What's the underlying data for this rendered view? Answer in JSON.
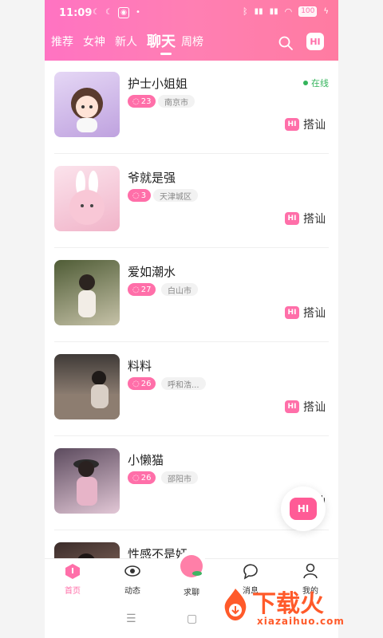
{
  "status": {
    "time": "11:09",
    "battery": "100"
  },
  "tabs": [
    {
      "label": "推荐"
    },
    {
      "label": "女神"
    },
    {
      "label": "新人"
    },
    {
      "label": "聊天"
    },
    {
      "label": "周榜"
    }
  ],
  "header": {
    "hi_label": "HI"
  },
  "items": [
    {
      "name": "护士小姐姐",
      "count": "23",
      "city": "南京市",
      "online": "在线",
      "greet": "搭讪",
      "greet_icon": "HI",
      "avatar_colors": [
        "#d9c8f0",
        "#bfa2df"
      ]
    },
    {
      "name": "爷就是强",
      "count": "3",
      "city": "天津城区",
      "greet": "搭讪",
      "greet_icon": "HI",
      "avatar_colors": [
        "#f7d5e2",
        "#f1b4c9"
      ]
    },
    {
      "name": "爱如潮水",
      "count": "27",
      "city": "白山市",
      "greet": "搭讪",
      "greet_icon": "HI",
      "avatar_colors": [
        "#5c6a41",
        "#c6c2a8"
      ]
    },
    {
      "name": "料料",
      "count": "26",
      "city": "呼和浩...",
      "greet": "搭讪",
      "greet_icon": "HI",
      "avatar_colors": [
        "#6a5a4f",
        "#b9a493"
      ]
    },
    {
      "name": "小懒猫",
      "count": "26",
      "city": "邵阳市",
      "greet": "搭讪",
      "greet_icon": "HI",
      "avatar_colors": [
        "#5c4b5e",
        "#e2c7d6"
      ]
    },
    {
      "name": "性感不是奸",
      "count": "",
      "city": "",
      "greet": "",
      "greet_icon": "",
      "avatar_colors": [
        "#3b2c2a",
        "#a07e6e"
      ]
    }
  ],
  "fab": {
    "label": "HI"
  },
  "tabbar": [
    {
      "label": "首页",
      "icon": "home-icon"
    },
    {
      "label": "动态",
      "icon": "eye-icon"
    },
    {
      "label": "求聊",
      "icon": "peach-icon"
    },
    {
      "label": "消息",
      "icon": "message-icon"
    },
    {
      "label": "我的",
      "icon": "user-icon"
    }
  ],
  "watermark": {
    "text": "下载火",
    "url": "xiazaihuo.com"
  },
  "colors": {
    "accent": "#ff6fa9",
    "online": "#33b45b"
  }
}
